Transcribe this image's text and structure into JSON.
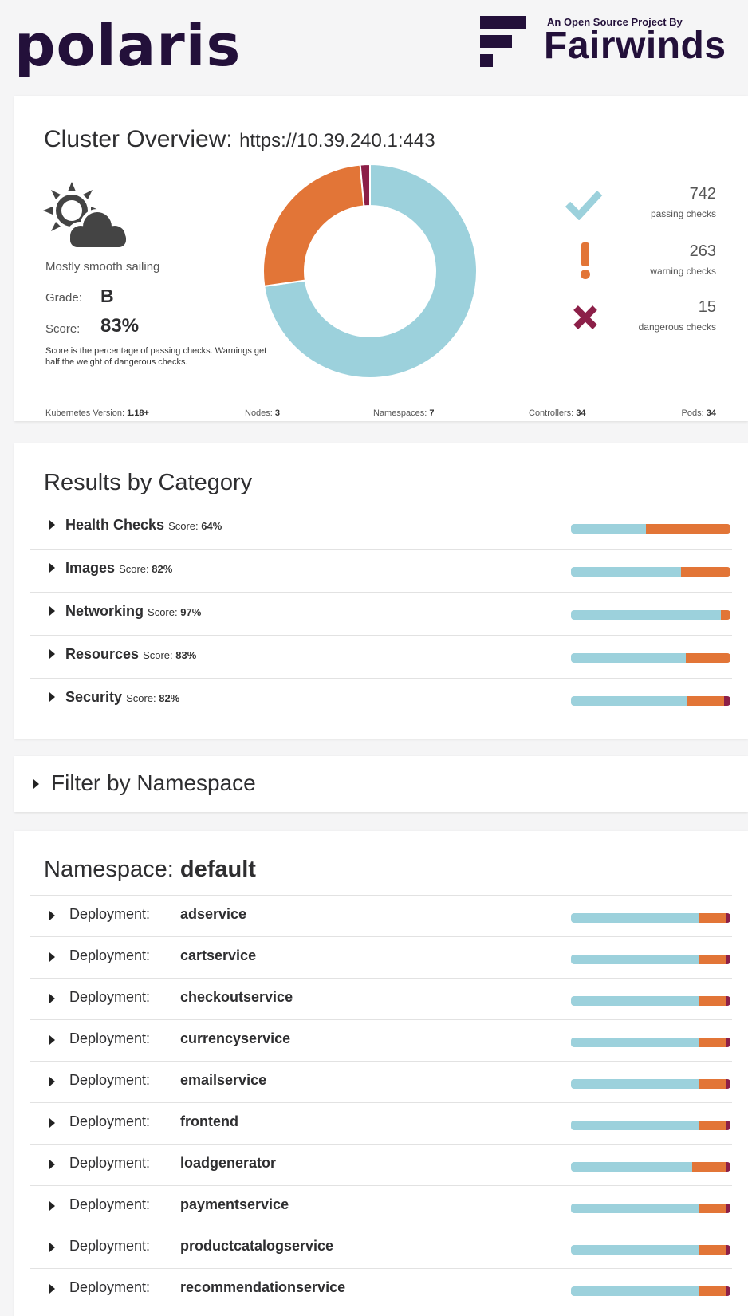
{
  "header": {
    "app_name": "polaris",
    "sponsor_tagline": "An Open Source Project By",
    "sponsor_name": "Fairwinds"
  },
  "colors": {
    "passing": "#9cd1dc",
    "warning": "#e27537",
    "danger": "#8c1f48",
    "brand": "#23103a"
  },
  "overview": {
    "title": "Cluster Overview:",
    "cluster_url": "https://10.39.240.1:443",
    "weather_icon": "partly-cloudy-icon",
    "mood": "Mostly smooth sailing",
    "grade_label": "Grade:",
    "grade": "B",
    "score_label": "Score:",
    "score": "83%",
    "score_note": "Score is the percentage of passing checks. Warnings get half the weight of dangerous checks.",
    "stats": [
      {
        "count": "742",
        "label": "passing checks",
        "icon": "checkmark-icon"
      },
      {
        "count": "263",
        "label": "warning checks",
        "icon": "exclamation-icon"
      },
      {
        "count": "15",
        "label": "dangerous checks",
        "icon": "cross-icon"
      }
    ],
    "footer": [
      {
        "label": "Kubernetes Version:",
        "value": "1.18+"
      },
      {
        "label": "Nodes:",
        "value": "3"
      },
      {
        "label": "Namespaces:",
        "value": "7"
      },
      {
        "label": "Controllers:",
        "value": "34"
      },
      {
        "label": "Pods:",
        "value": "34"
      }
    ]
  },
  "chart_data": {
    "type": "pie",
    "categories": [
      "passing checks",
      "warning checks",
      "dangerous checks"
    ],
    "values": [
      742,
      263,
      15
    ],
    "colors": [
      "#9cd1dc",
      "#e27537",
      "#8c1f48"
    ]
  },
  "categories": {
    "title": "Results by Category",
    "score_label": "Score:",
    "items": [
      {
        "name": "Health Checks",
        "score": "64%",
        "passing": 0.47,
        "warning": 0.53,
        "danger": 0.0
      },
      {
        "name": "Images",
        "score": "82%",
        "passing": 0.69,
        "warning": 0.31,
        "danger": 0.0
      },
      {
        "name": "Networking",
        "score": "97%",
        "passing": 0.94,
        "warning": 0.06,
        "danger": 0.0
      },
      {
        "name": "Resources",
        "score": "83%",
        "passing": 0.72,
        "warning": 0.28,
        "danger": 0.0
      },
      {
        "name": "Security",
        "score": "82%",
        "passing": 0.73,
        "warning": 0.23,
        "danger": 0.04
      }
    ]
  },
  "filter": {
    "title": "Filter by Namespace"
  },
  "namespace": {
    "label": "Namespace:",
    "name": "default",
    "kind_label": "Deployment:",
    "deployments": [
      {
        "name": "adservice",
        "passing": 0.8,
        "warning": 0.17,
        "danger": 0.03
      },
      {
        "name": "cartservice",
        "passing": 0.8,
        "warning": 0.17,
        "danger": 0.03
      },
      {
        "name": "checkoutservice",
        "passing": 0.8,
        "warning": 0.17,
        "danger": 0.03
      },
      {
        "name": "currencyservice",
        "passing": 0.8,
        "warning": 0.17,
        "danger": 0.03
      },
      {
        "name": "emailservice",
        "passing": 0.8,
        "warning": 0.17,
        "danger": 0.03
      },
      {
        "name": "frontend",
        "passing": 0.8,
        "warning": 0.17,
        "danger": 0.03
      },
      {
        "name": "loadgenerator",
        "passing": 0.76,
        "warning": 0.21,
        "danger": 0.03
      },
      {
        "name": "paymentservice",
        "passing": 0.8,
        "warning": 0.17,
        "danger": 0.03
      },
      {
        "name": "productcatalogservice",
        "passing": 0.8,
        "warning": 0.17,
        "danger": 0.03
      },
      {
        "name": "recommendationservice",
        "passing": 0.8,
        "warning": 0.17,
        "danger": 0.03
      }
    ]
  }
}
